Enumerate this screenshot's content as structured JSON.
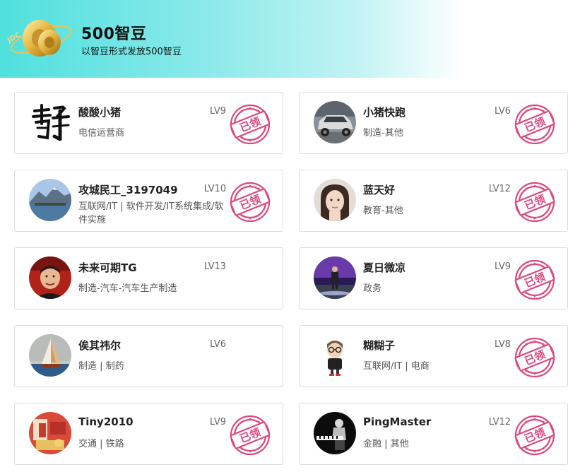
{
  "header": {
    "logo_text": "JDC",
    "title": "500智豆",
    "subtitle": "以智豆形式发放500智豆"
  },
  "stamp_label": "已领",
  "colors": {
    "stamp": "#e0467e",
    "banner_start": "#4fe0dd",
    "banner_end": "#ffffff"
  },
  "users": [
    {
      "name": "酸酸小猪",
      "level": "LV9",
      "desc": "电信运营商",
      "avatar": "calligraphy-avatar"
    },
    {
      "name": "小猪快跑",
      "level": "LV6",
      "desc": "制造-其他",
      "avatar": "car-avatar"
    },
    {
      "name": "攻城民工_3197049",
      "level": "LV10",
      "desc": "互联网/IT | 软件开发/IT系统集成/软件实施",
      "avatar": "lake-mountain-avatar"
    },
    {
      "name": "蓝天好",
      "level": "LV12",
      "desc": "教育-其他",
      "avatar": "portrait-avatar"
    },
    {
      "name": "未来可期TG",
      "level": "LV13",
      "desc": "制造-汽车-汽车生产制造",
      "avatar": "performer-avatar"
    },
    {
      "name": "夏日微凉",
      "level": "LV9",
      "desc": "政务",
      "avatar": "stage-avatar"
    },
    {
      "name": "俟其祎尔",
      "level": "LV6",
      "desc": "制造 | 制药",
      "avatar": "sailboat-avatar"
    },
    {
      "name": "糊糊子",
      "level": "LV8",
      "desc": "互联网/IT | 电商",
      "avatar": "cartoon-avatar"
    },
    {
      "name": "Tiny2010",
      "level": "LV9",
      "desc": "交通 | 铁路",
      "avatar": "red-room-avatar"
    },
    {
      "name": "PingMaster",
      "level": "LV12",
      "desc": "金融 | 其他",
      "avatar": "pianist-avatar"
    }
  ]
}
